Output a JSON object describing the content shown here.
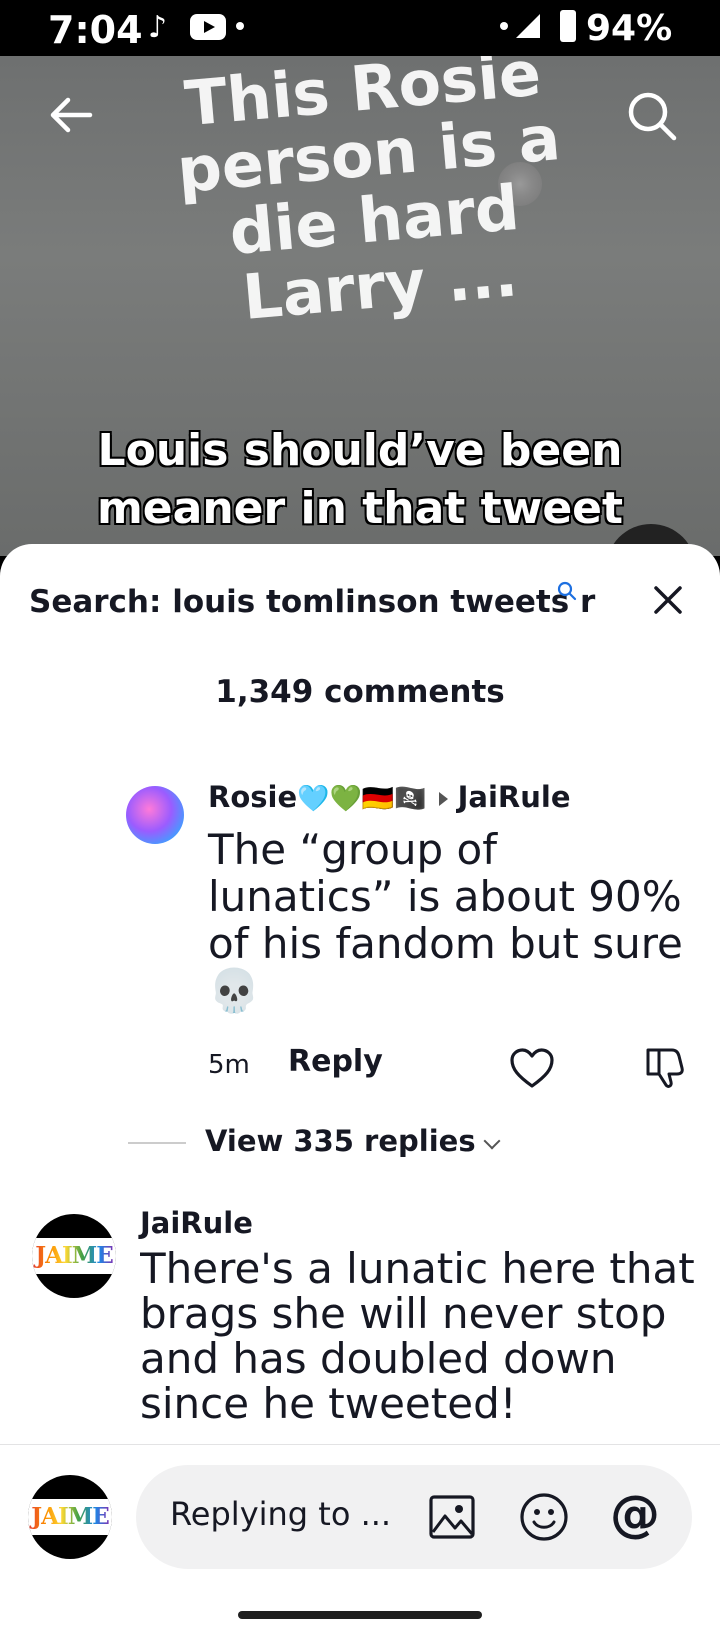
{
  "status_bar": {
    "time": "7:04",
    "battery": "94%"
  },
  "video": {
    "overlay_text": "This Rosie person is a die hard Larry ...",
    "caption": "Louis should’ve been meaner in that tweet"
  },
  "sheet": {
    "title": "Search: louis tomlinson tweets r",
    "comment_count": "1,349 comments"
  },
  "comments": [
    {
      "author": "Rosie",
      "author_emojis": "🩵💚🇩🇪🏴‍☠️",
      "reply_to": "JaiRule",
      "text": "The “group of lunatics” is about 90% of his fandom but sure 💀",
      "time": "5m",
      "reply_label": "Reply",
      "view_replies": "View 335 replies"
    },
    {
      "author": "JaiRule",
      "avatar_text": "JAIME",
      "text": "There's a lunatic here that brags she will never stop and has doubled down since he tweeted!"
    }
  ],
  "input_bar": {
    "placeholder": "Replying to ...",
    "avatar_text": "JAIME"
  },
  "colors": {
    "text": "#161823",
    "sheet_bg": "#ffffff",
    "input_bg": "#f1f1f2"
  }
}
